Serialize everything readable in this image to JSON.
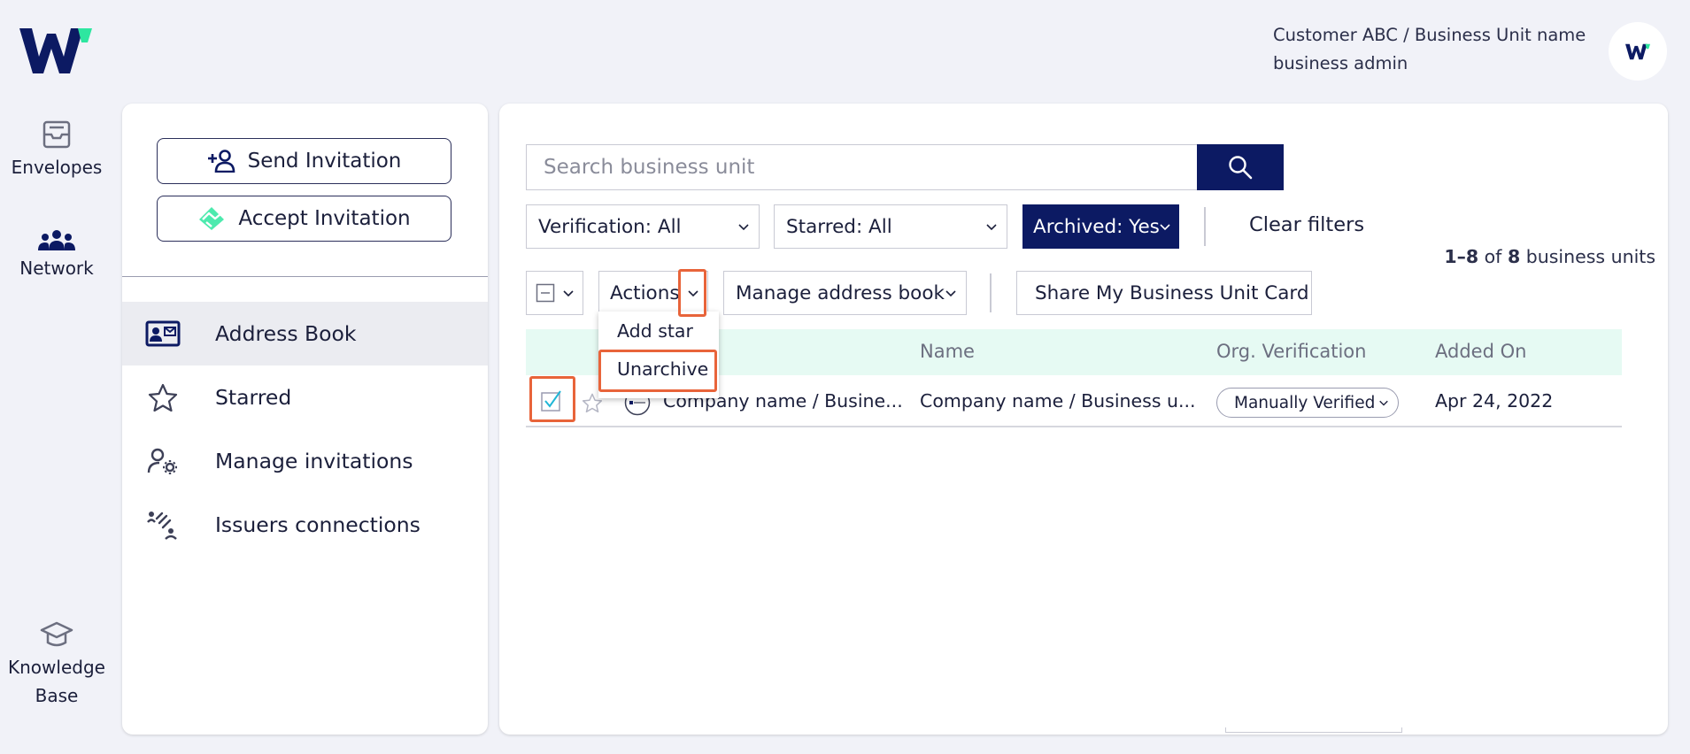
{
  "rail": {
    "items": [
      {
        "label": "Envelopes",
        "icon": "envelopes-icon"
      },
      {
        "label": "Network",
        "icon": "network-icon"
      },
      {
        "label": "Knowledge\nBase",
        "icon": "graduation-cap-icon"
      }
    ]
  },
  "header": {
    "breadcrumb": "Customer ABC / Business Unit name",
    "role": "business admin"
  },
  "sidebar": {
    "send_invitation": "Send Invitation",
    "accept_invitation": "Accept Invitation",
    "items": [
      {
        "label": "Address Book",
        "icon": "address-card-icon",
        "active": true
      },
      {
        "label": "Starred",
        "icon": "star-icon"
      },
      {
        "label": "Manage invitations",
        "icon": "user-settings-icon"
      },
      {
        "label": "Issuers connections",
        "icon": "connections-icon"
      }
    ]
  },
  "main": {
    "search_placeholder": "Search business unit",
    "filters": {
      "verification": "Verification: All",
      "starred": "Starred: All",
      "archived": "Archived: Yes",
      "clear": "Clear filters"
    },
    "count": {
      "range": "1–8",
      "of": "of",
      "total": "8",
      "suffix": "business units"
    },
    "toolbar": {
      "actions": "Actions",
      "manage_address_book": "Manage address book",
      "share_card": "Share My Business Unit Card"
    },
    "actions_menu": [
      "Add star",
      "Unarchive"
    ],
    "table": {
      "columns": [
        "Name",
        "Org. Verification",
        "Added On"
      ],
      "rows": [
        {
          "unit": "Company name / Busine...",
          "name": "Company name / Business u...",
          "verification": "Manually Verified",
          "added_on": "Apr 24, 2022",
          "checked": true
        }
      ]
    }
  },
  "colors": {
    "brand_navy": "#0c1a63",
    "brand_green": "#2ee6a0",
    "highlight": "#e8643a",
    "table_header": "#e6faf3"
  }
}
